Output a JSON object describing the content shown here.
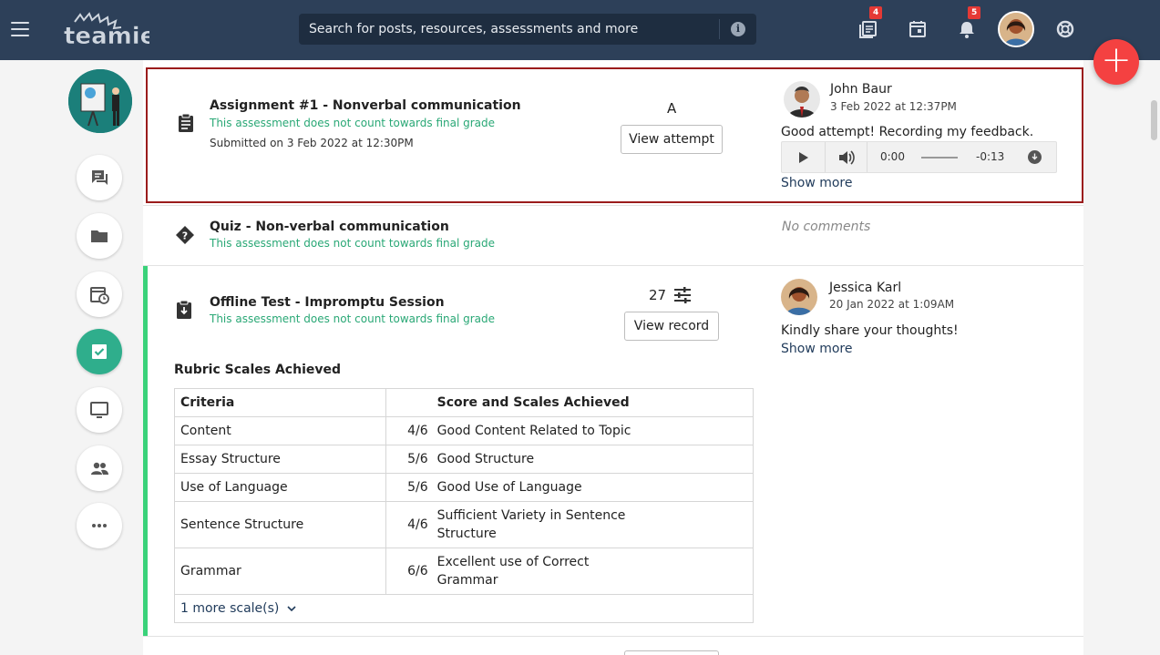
{
  "topbar": {
    "logo_text": "teamie",
    "search_placeholder": "Search for posts, resources, assessments and more",
    "info_icon": "i",
    "posts_badge": "4",
    "notifications_badge": "5"
  },
  "fab_label": "+",
  "items": [
    {
      "title": "Assignment #1 - Nonverbal communication",
      "note": "This assessment does not count towards final grade",
      "submitted": "Submitted on 3 Feb 2022 at 12:30PM",
      "grade": "A",
      "action": "View attempt",
      "comment": {
        "author": "John Baur",
        "date": "3 Feb 2022 at 12:37PM",
        "text": "Good attempt! Recording my feedback.",
        "audio_current": "0:00",
        "audio_remaining": "-0:13",
        "show_more": "Show more"
      }
    },
    {
      "title": "Quiz - Non-verbal communication",
      "note": "This assessment does not count towards final grade",
      "no_comments": "No comments"
    },
    {
      "title": "Offline Test - Impromptu Session",
      "note": "This assessment does not count towards final grade",
      "score": "27",
      "action": "View record",
      "comment": {
        "author": "Jessica Karl",
        "date": "20 Jan 2022 at 1:09AM",
        "text": "Kindly share your thoughts!",
        "show_more": "Show more"
      },
      "rubric": {
        "heading": "Rubric Scales Achieved",
        "col_criteria": "Criteria",
        "col_score": "Score and Scales Achieved",
        "rows": [
          {
            "criteria": "Content",
            "score": "4/6",
            "scale": "Good Content Related to Topic"
          },
          {
            "criteria": "Essay Structure",
            "score": "5/6",
            "scale": "Good Structure"
          },
          {
            "criteria": "Use of Language",
            "score": "5/6",
            "scale": "Good Use of Language"
          },
          {
            "criteria": "Sentence Structure",
            "score": "4/6",
            "scale_line1": "Sufficient Variety in Sentence",
            "scale_line2": "Structure"
          },
          {
            "criteria": "Grammar",
            "score": "6/6",
            "scale_line1": "Excellent use of Correct",
            "scale_line2": "Grammar"
          }
        ],
        "more": "1 more scale(s)"
      }
    }
  ],
  "colors": {
    "topbar": "#2d4059",
    "accent_green": "#2aa876",
    "fab": "#f44141",
    "highlight_border": "#9b1c1c"
  }
}
